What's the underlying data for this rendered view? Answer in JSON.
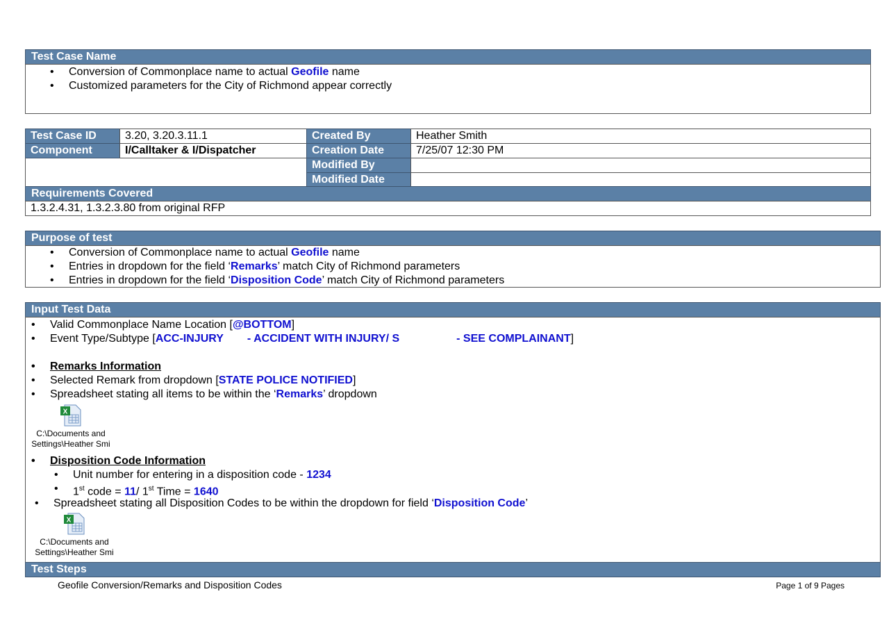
{
  "test_case_name": {
    "header": "Test Case Name",
    "items": [
      [
        "Conversion of Commonplace name to actual ",
        "Geofile",
        " name"
      ],
      [
        "Customized parameters for the City of Richmond appear correctly"
      ]
    ]
  },
  "info": {
    "test_case_id_label": "Test Case ID",
    "test_case_id": "3.20, 3.20.3.11.1",
    "component_label": "Component",
    "component": "I/Calltaker & I/Dispatcher",
    "created_by_label": "Created By",
    "created_by": "Heather Smith",
    "creation_date_label": "Creation Date",
    "creation_date": "7/25/07 12:30 PM",
    "modified_by_label": "Modified By",
    "modified_by": "",
    "modified_date_label": "Modified Date",
    "modified_date": ""
  },
  "requirements": {
    "header": "Requirements Covered",
    "value": "1.3.2.4.31, 1.3.2.3.80 from original RFP"
  },
  "purpose": {
    "header": "Purpose of test",
    "items": [
      [
        "Conversion of Commonplace name to actual ",
        "Geofile",
        " name"
      ],
      [
        "Entries in dropdown for the field ‘",
        "Remarks",
        "’ match City of Richmond parameters"
      ],
      [
        "Entries in dropdown for the field ‘",
        "Disposition Code",
        "’ match City of Richmond parameters"
      ]
    ]
  },
  "input": {
    "header": "Input Test Data",
    "location": [
      "Valid Commonplace Name Location [",
      "@BOTTOM",
      "]"
    ],
    "event": [
      "Event Type/Subtype [",
      "ACC-INJURY",
      "- ACCIDENT WITH INJURY/ S",
      "- SEE COMPLAINANT",
      "]"
    ],
    "remarks_title": "Remarks Information",
    "remark_selected": [
      "Selected Remark from dropdown [",
      "STATE POLICE NOTIFIED",
      "]"
    ],
    "remarks_sheet": [
      "Spreadsheet stating all items to be within the ‘",
      "Remarks",
      "’ dropdown"
    ],
    "attachment1": [
      "C:\\Documents and",
      "Settings\\Heather Smi"
    ],
    "disp_title": "Disposition Code Information",
    "unit": [
      "Unit number for entering in a disposition code - ",
      "1234"
    ],
    "code": [
      "1",
      "st",
      " code = ",
      "11",
      "/ 1",
      "st",
      " Time = ",
      "1640"
    ],
    "disp_sheet": [
      "Spreadsheet stating all Disposition Codes to be within the dropdown for field ‘",
      "Disposition Code",
      "’"
    ],
    "attachment2": [
      "C:\\Documents and",
      "Settings\\Heather Smi"
    ],
    "attachment_icon": "excel-file-icon"
  },
  "test_steps": {
    "header": "Test Steps"
  },
  "footer": {
    "title": "Geofile Conversion/Remarks and Disposition Codes",
    "page": "Page 1 of 9 Pages"
  },
  "colors": {
    "header_bg": "#5b80a6",
    "highlight": "#1010d0"
  }
}
